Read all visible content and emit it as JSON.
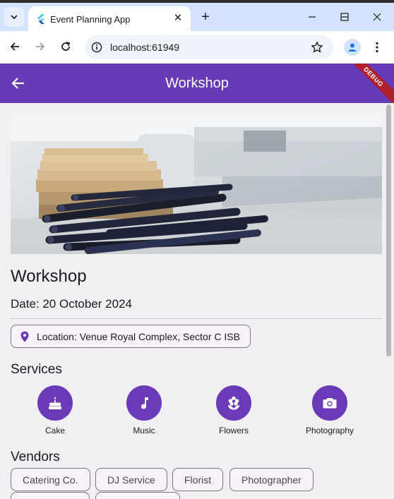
{
  "browser": {
    "tab_title": "Event Planning App",
    "url": "localhost:61949",
    "tab_close_glyph": "✕",
    "new_tab_glyph": "+"
  },
  "app": {
    "appbar_title": "Workshop",
    "debug_banner": "DEBUG",
    "theme_color": "#673ab7"
  },
  "event": {
    "name": "Workshop",
    "date": "Date: 20 October 2024",
    "location": "Location: Venue Royal Complex, Sector C ISB"
  },
  "services": {
    "title": "Services",
    "items": [
      {
        "label": "Cake",
        "icon": "cake-icon"
      },
      {
        "label": "Music",
        "icon": "music-note-icon"
      },
      {
        "label": "Flowers",
        "icon": "flower-icon"
      },
      {
        "label": "Photography",
        "icon": "camera-icon"
      }
    ]
  },
  "vendors": {
    "title": "Vendors",
    "items": [
      "Catering Co.",
      "DJ Service",
      "Florist",
      "Photographer"
    ]
  }
}
